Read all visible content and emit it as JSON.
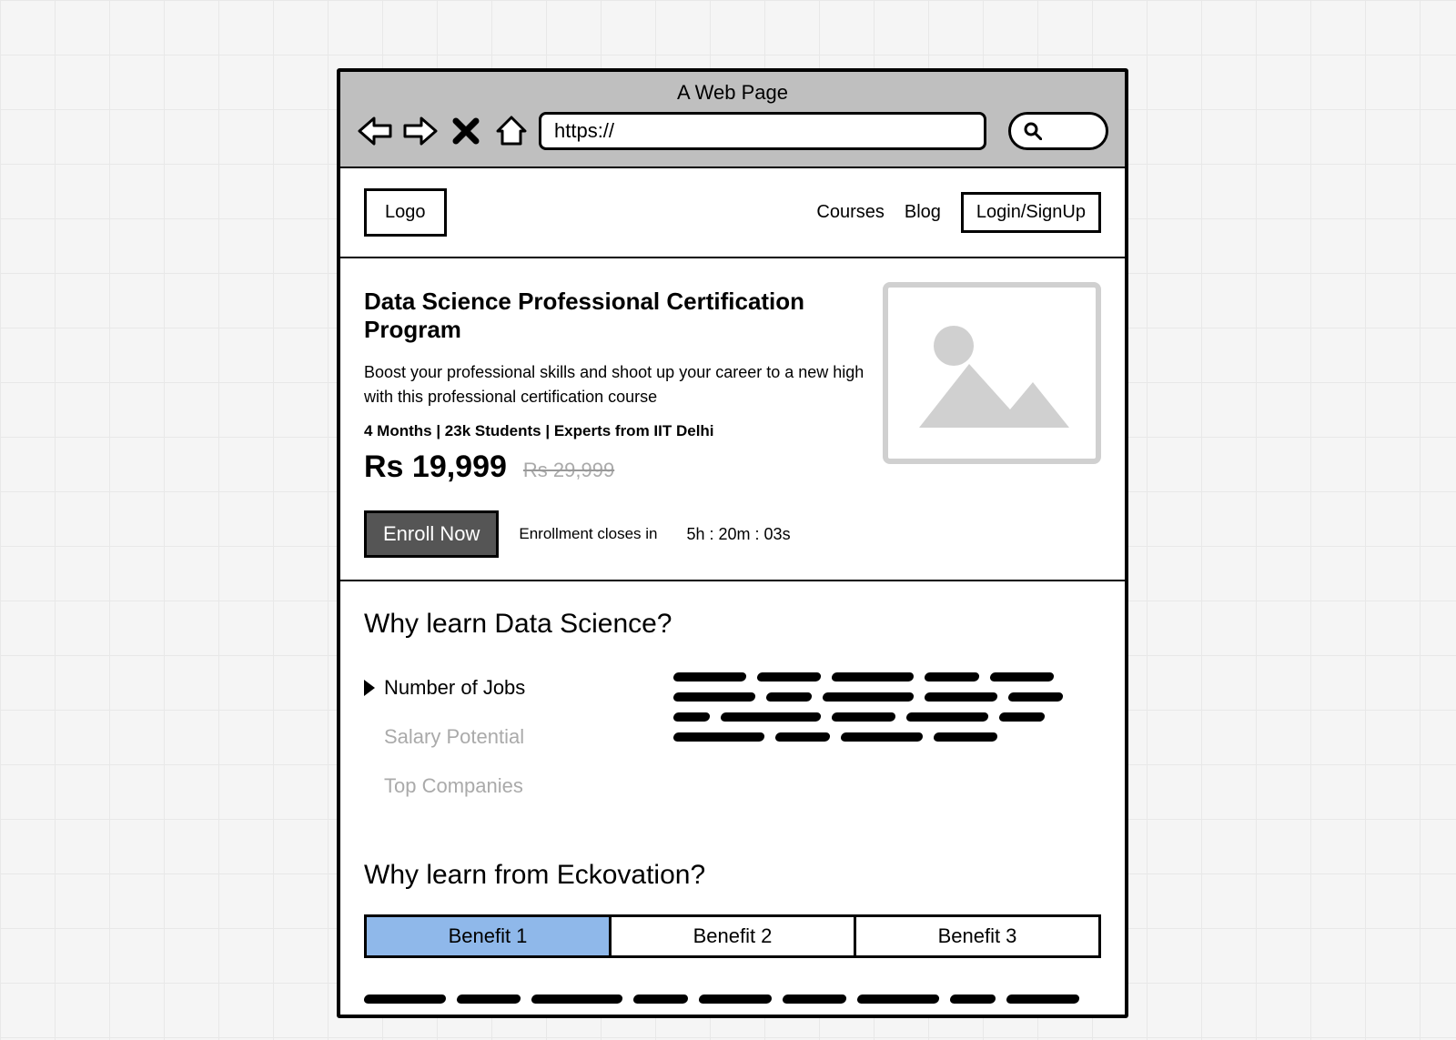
{
  "browser": {
    "title": "A Web Page",
    "url": "https://"
  },
  "nav": {
    "logo": "Logo",
    "links": [
      "Courses",
      "Blog"
    ],
    "login": "Login/SignUp"
  },
  "hero": {
    "title": "Data Science Professional Certification Program",
    "subtitle": "Boost your professional skills and shoot up your career to a new high with this professional certification course",
    "meta": "4 Months | 23k Students | Experts from IIT Delhi",
    "price": "Rs 19,999",
    "price_old": "Rs 29,999",
    "enroll": "Enroll Now",
    "countdown_label": "Enrollment closes in",
    "countdown_value": "5h : 20m : 03s"
  },
  "why_learn": {
    "heading": "Why learn Data Science?",
    "items": [
      {
        "label": "Number of Jobs",
        "active": true
      },
      {
        "label": "Salary Potential",
        "active": false
      },
      {
        "label": "Top Companies",
        "active": false
      }
    ]
  },
  "why_from": {
    "heading": "Why learn from Eckovation?",
    "tabs": [
      "Benefit 1",
      "Benefit 2",
      "Benefit 3"
    ],
    "active_tab": 0
  }
}
